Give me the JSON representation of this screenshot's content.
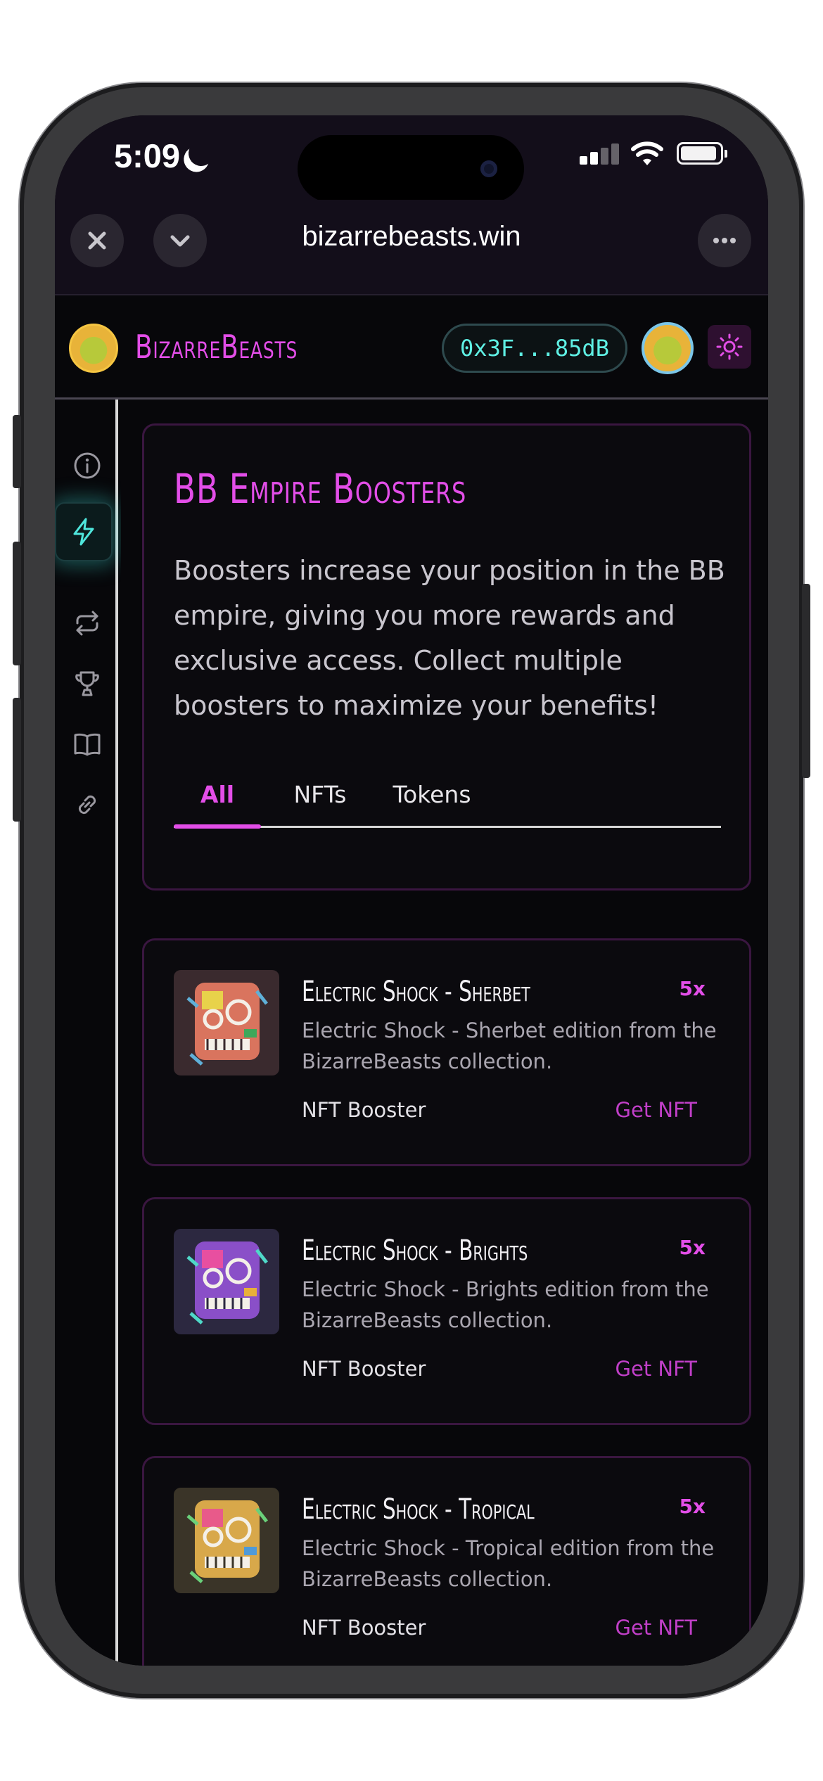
{
  "status_bar": {
    "time": "5:09"
  },
  "browser": {
    "url": "bizarrebeasts.win"
  },
  "header": {
    "brand": "BizarreBeasts",
    "wallet": "0x3F...85dB"
  },
  "sidebar": {
    "items": [
      {
        "icon": "info-icon"
      },
      {
        "icon": "lightning-icon",
        "active": true
      },
      {
        "icon": "swap-icon"
      },
      {
        "icon": "trophy-icon"
      },
      {
        "icon": "book-icon"
      },
      {
        "icon": "link-icon"
      }
    ]
  },
  "intro": {
    "title": "BB Empire Boosters",
    "description": "Boosters increase your position in the BB empire, giving you more rewards and exclusive access. Collect multiple boosters to maximize your benefits!",
    "tabs": [
      {
        "label": "All",
        "active": true
      },
      {
        "label": "NFTs"
      },
      {
        "label": "Tokens"
      }
    ]
  },
  "boosters": [
    {
      "name": "Electric Shock - Sherbet",
      "multiplier": "5x",
      "description": "Electric Shock - Sherbet edition from the BizarreBeasts collection.",
      "type": "NFT Booster",
      "action": "Get NFT"
    },
    {
      "name": "Electric Shock - Brights",
      "multiplier": "5x",
      "description": "Electric Shock - Brights edition from the BizarreBeasts collection.",
      "type": "NFT Booster",
      "action": "Get NFT"
    },
    {
      "name": "Electric Shock - Tropical",
      "multiplier": "5x",
      "description": "Electric Shock - Tropical edition from the BizarreBeasts collection.",
      "type": "NFT Booster",
      "action": "Get NFT"
    }
  ],
  "colors": {
    "accent": "#e34ee8",
    "cyan": "#5ff0e4",
    "background": "#07070a"
  }
}
